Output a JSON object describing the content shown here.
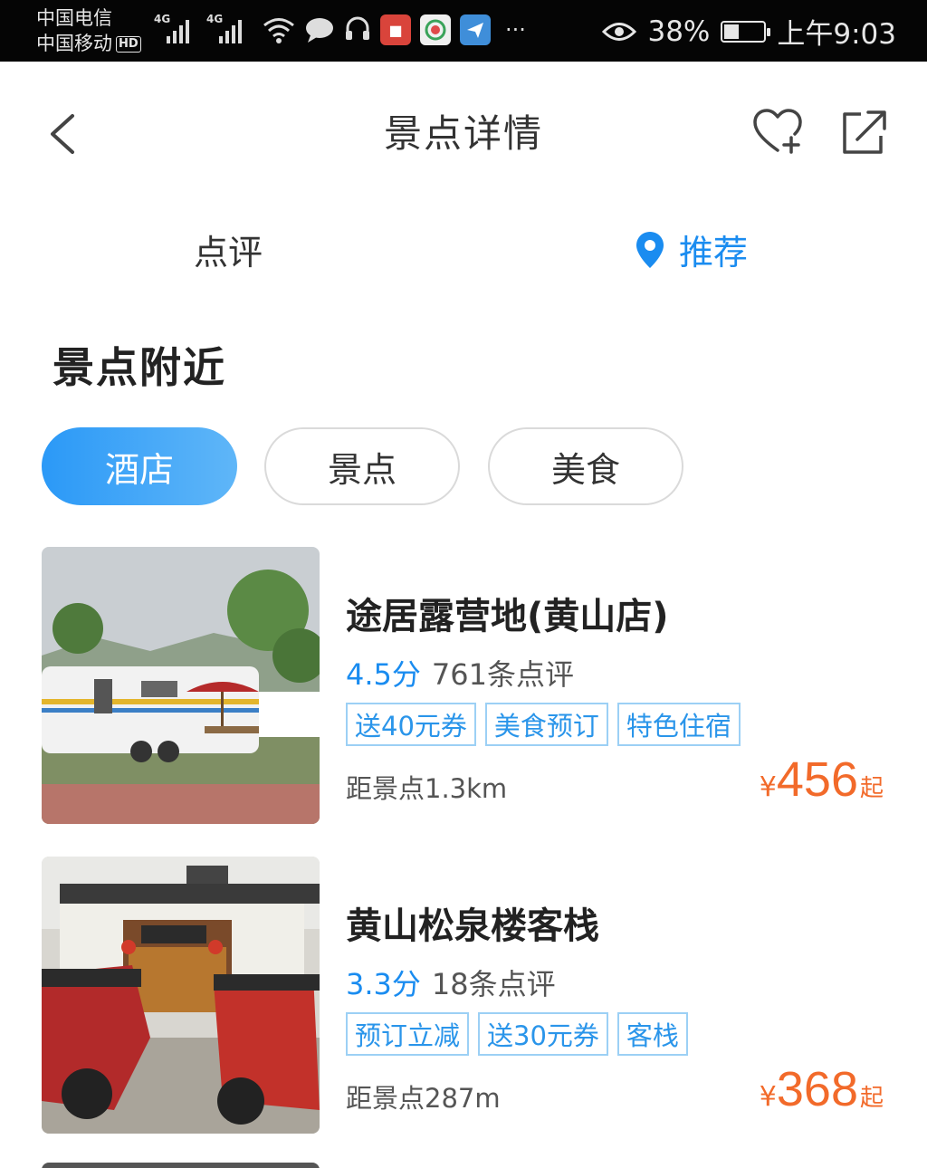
{
  "status_bar": {
    "carrier_1": "中国电信",
    "carrier_2": "中国移动",
    "hd_badge": "HD",
    "network_1": "4G",
    "network_2": "4G",
    "more": "···",
    "battery_percent": "38%",
    "time": "上午9:03"
  },
  "header": {
    "title": "景点详情"
  },
  "tabs": {
    "review": "点评",
    "recommend": "推荐"
  },
  "section": {
    "title": "景点附近"
  },
  "filters": [
    {
      "label": "酒店",
      "active": true
    },
    {
      "label": "景点",
      "active": false
    },
    {
      "label": "美食",
      "active": false
    }
  ],
  "hotels": [
    {
      "name": "途居露营地(黄山店)",
      "score": "4.5分",
      "reviews": "761条点评",
      "tags": [
        "送40元券",
        "美食预订",
        "特色住宿"
      ],
      "distance": "距景点1.3km",
      "currency": "¥",
      "price": "456",
      "price_suffix": "起"
    },
    {
      "name": "黄山松泉楼客栈",
      "score": "3.3分",
      "reviews": "18条点评",
      "tags": [
        "预订立减",
        "送30元券",
        "客栈"
      ],
      "distance": "距景点287m",
      "currency": "¥",
      "price": "368",
      "price_suffix": "起"
    }
  ],
  "colors": {
    "accent_blue": "#1a8cf0",
    "price_orange": "#f26a2a",
    "tag_border": "#9cd0f5"
  }
}
